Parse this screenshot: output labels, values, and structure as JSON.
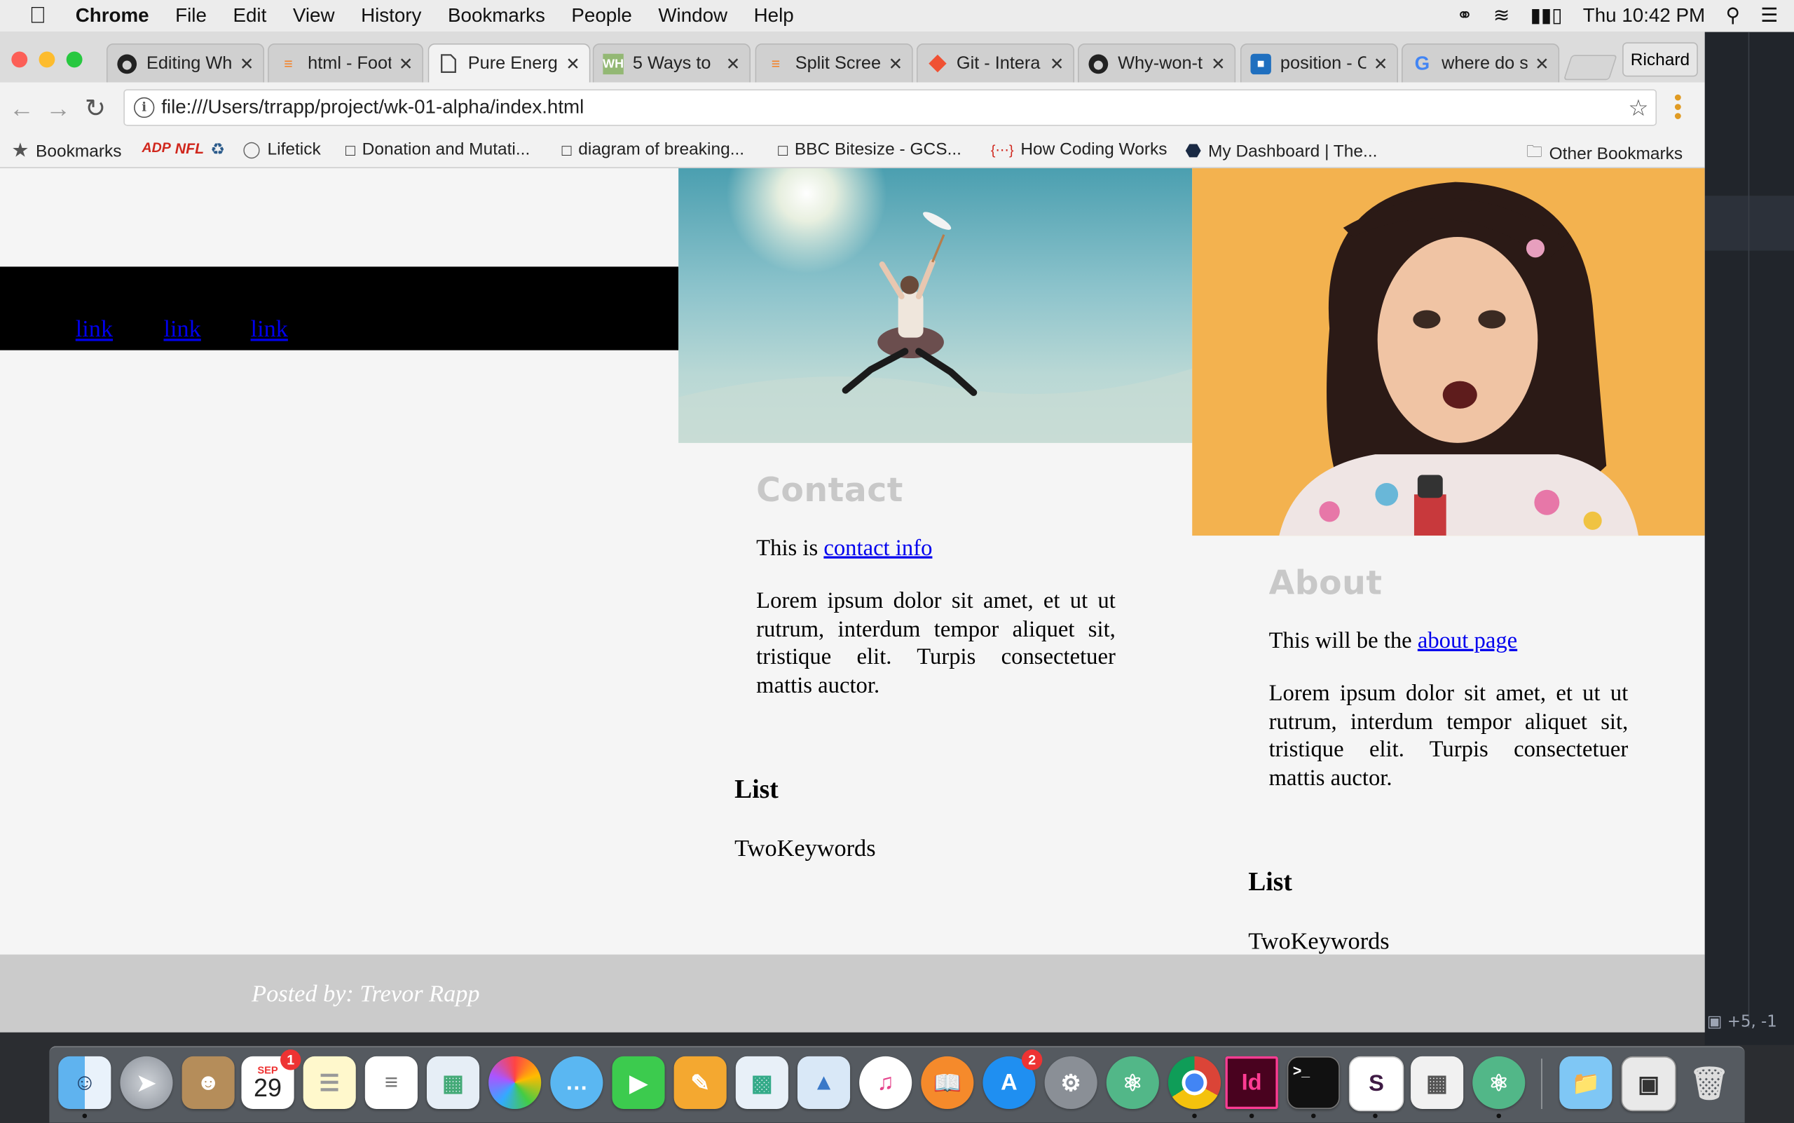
{
  "menubar": {
    "apple": "",
    "items": [
      "Chrome",
      "File",
      "Edit",
      "View",
      "History",
      "Bookmarks",
      "People",
      "Window",
      "Help"
    ],
    "clock": "Thu 10:42 PM"
  },
  "tabs": [
    {
      "label": "Editing Wh",
      "icon": "github-icon"
    },
    {
      "label": "html - Foot",
      "icon": "stackoverflow-icon"
    },
    {
      "label": "Pure Energ",
      "icon": "page-icon"
    },
    {
      "label": "5 Ways to",
      "icon": "wikihow-icon"
    },
    {
      "label": "Split Scree",
      "icon": "stackoverflow-icon"
    },
    {
      "label": "Git - Intera",
      "icon": "git-icon"
    },
    {
      "label": "Why-won-t",
      "icon": "github-icon"
    },
    {
      "label": "position - C",
      "icon": "page-icon"
    },
    {
      "label": "where do s",
      "icon": "google-icon"
    }
  ],
  "profile": "Richard",
  "address": {
    "url": "file:///Users/trrapp/project/wk-01-alpha/index.html"
  },
  "bookmarks": {
    "items": [
      "Bookmarks",
      "Lifetick",
      "Donation and Mutati...",
      "diagram of breaking...",
      "BBC Bitesize - GCS...",
      "How Coding Works",
      "My Dashboard | The..."
    ],
    "other": "Other Bookmarks"
  },
  "page": {
    "nav_links": [
      "link",
      "link",
      "link"
    ],
    "contact": {
      "heading": "Contact",
      "intro": "This is ",
      "link": "contact info",
      "body": "Lorem ipsum dolor sit amet, et ut ut rutrum, interdum tempor aliquet sit, tristique elit. Turpis consectetuer mattis auctor.",
      "list_heading": "List",
      "list_item": "TwoKeywords"
    },
    "about": {
      "heading": "About",
      "intro": "This will be the ",
      "link": "about page",
      "body": "Lorem ipsum dolor sit amet, et ut ut rutrum, interdum tempor aliquet sit, tristique elit. Turpis consectetuer mattis auctor.",
      "list_heading": "List",
      "list_item": "TwoKeywords"
    },
    "footer": "Posted by: Trevor Rapp"
  },
  "editor_status": "+5, -1",
  "dock": {
    "calendar_month": "SEP",
    "calendar_day": "29",
    "calendar_badge": "1",
    "appstore_badge": "2"
  }
}
